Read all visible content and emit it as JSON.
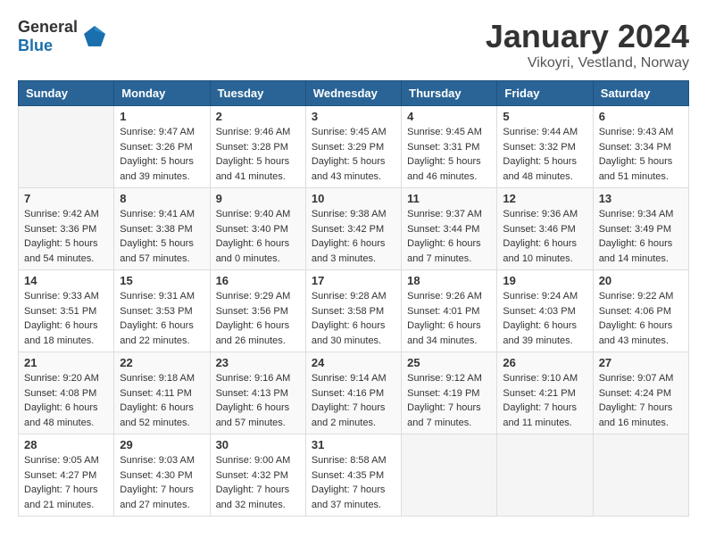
{
  "header": {
    "logo_general": "General",
    "logo_blue": "Blue",
    "title": "January 2024",
    "subtitle": "Vikoyri, Vestland, Norway"
  },
  "calendar": {
    "headers": [
      "Sunday",
      "Monday",
      "Tuesday",
      "Wednesday",
      "Thursday",
      "Friday",
      "Saturday"
    ],
    "rows": [
      [
        {
          "day": "",
          "info": ""
        },
        {
          "day": "1",
          "info": "Sunrise: 9:47 AM\nSunset: 3:26 PM\nDaylight: 5 hours\nand 39 minutes."
        },
        {
          "day": "2",
          "info": "Sunrise: 9:46 AM\nSunset: 3:28 PM\nDaylight: 5 hours\nand 41 minutes."
        },
        {
          "day": "3",
          "info": "Sunrise: 9:45 AM\nSunset: 3:29 PM\nDaylight: 5 hours\nand 43 minutes."
        },
        {
          "day": "4",
          "info": "Sunrise: 9:45 AM\nSunset: 3:31 PM\nDaylight: 5 hours\nand 46 minutes."
        },
        {
          "day": "5",
          "info": "Sunrise: 9:44 AM\nSunset: 3:32 PM\nDaylight: 5 hours\nand 48 minutes."
        },
        {
          "day": "6",
          "info": "Sunrise: 9:43 AM\nSunset: 3:34 PM\nDaylight: 5 hours\nand 51 minutes."
        }
      ],
      [
        {
          "day": "7",
          "info": "Sunrise: 9:42 AM\nSunset: 3:36 PM\nDaylight: 5 hours\nand 54 minutes."
        },
        {
          "day": "8",
          "info": "Sunrise: 9:41 AM\nSunset: 3:38 PM\nDaylight: 5 hours\nand 57 minutes."
        },
        {
          "day": "9",
          "info": "Sunrise: 9:40 AM\nSunset: 3:40 PM\nDaylight: 6 hours\nand 0 minutes."
        },
        {
          "day": "10",
          "info": "Sunrise: 9:38 AM\nSunset: 3:42 PM\nDaylight: 6 hours\nand 3 minutes."
        },
        {
          "day": "11",
          "info": "Sunrise: 9:37 AM\nSunset: 3:44 PM\nDaylight: 6 hours\nand 7 minutes."
        },
        {
          "day": "12",
          "info": "Sunrise: 9:36 AM\nSunset: 3:46 PM\nDaylight: 6 hours\nand 10 minutes."
        },
        {
          "day": "13",
          "info": "Sunrise: 9:34 AM\nSunset: 3:49 PM\nDaylight: 6 hours\nand 14 minutes."
        }
      ],
      [
        {
          "day": "14",
          "info": "Sunrise: 9:33 AM\nSunset: 3:51 PM\nDaylight: 6 hours\nand 18 minutes."
        },
        {
          "day": "15",
          "info": "Sunrise: 9:31 AM\nSunset: 3:53 PM\nDaylight: 6 hours\nand 22 minutes."
        },
        {
          "day": "16",
          "info": "Sunrise: 9:29 AM\nSunset: 3:56 PM\nDaylight: 6 hours\nand 26 minutes."
        },
        {
          "day": "17",
          "info": "Sunrise: 9:28 AM\nSunset: 3:58 PM\nDaylight: 6 hours\nand 30 minutes."
        },
        {
          "day": "18",
          "info": "Sunrise: 9:26 AM\nSunset: 4:01 PM\nDaylight: 6 hours\nand 34 minutes."
        },
        {
          "day": "19",
          "info": "Sunrise: 9:24 AM\nSunset: 4:03 PM\nDaylight: 6 hours\nand 39 minutes."
        },
        {
          "day": "20",
          "info": "Sunrise: 9:22 AM\nSunset: 4:06 PM\nDaylight: 6 hours\nand 43 minutes."
        }
      ],
      [
        {
          "day": "21",
          "info": "Sunrise: 9:20 AM\nSunset: 4:08 PM\nDaylight: 6 hours\nand 48 minutes."
        },
        {
          "day": "22",
          "info": "Sunrise: 9:18 AM\nSunset: 4:11 PM\nDaylight: 6 hours\nand 52 minutes."
        },
        {
          "day": "23",
          "info": "Sunrise: 9:16 AM\nSunset: 4:13 PM\nDaylight: 6 hours\nand 57 minutes."
        },
        {
          "day": "24",
          "info": "Sunrise: 9:14 AM\nSunset: 4:16 PM\nDaylight: 7 hours\nand 2 minutes."
        },
        {
          "day": "25",
          "info": "Sunrise: 9:12 AM\nSunset: 4:19 PM\nDaylight: 7 hours\nand 7 minutes."
        },
        {
          "day": "26",
          "info": "Sunrise: 9:10 AM\nSunset: 4:21 PM\nDaylight: 7 hours\nand 11 minutes."
        },
        {
          "day": "27",
          "info": "Sunrise: 9:07 AM\nSunset: 4:24 PM\nDaylight: 7 hours\nand 16 minutes."
        }
      ],
      [
        {
          "day": "28",
          "info": "Sunrise: 9:05 AM\nSunset: 4:27 PM\nDaylight: 7 hours\nand 21 minutes."
        },
        {
          "day": "29",
          "info": "Sunrise: 9:03 AM\nSunset: 4:30 PM\nDaylight: 7 hours\nand 27 minutes."
        },
        {
          "day": "30",
          "info": "Sunrise: 9:00 AM\nSunset: 4:32 PM\nDaylight: 7 hours\nand 32 minutes."
        },
        {
          "day": "31",
          "info": "Sunrise: 8:58 AM\nSunset: 4:35 PM\nDaylight: 7 hours\nand 37 minutes."
        },
        {
          "day": "",
          "info": ""
        },
        {
          "day": "",
          "info": ""
        },
        {
          "day": "",
          "info": ""
        }
      ]
    ]
  }
}
